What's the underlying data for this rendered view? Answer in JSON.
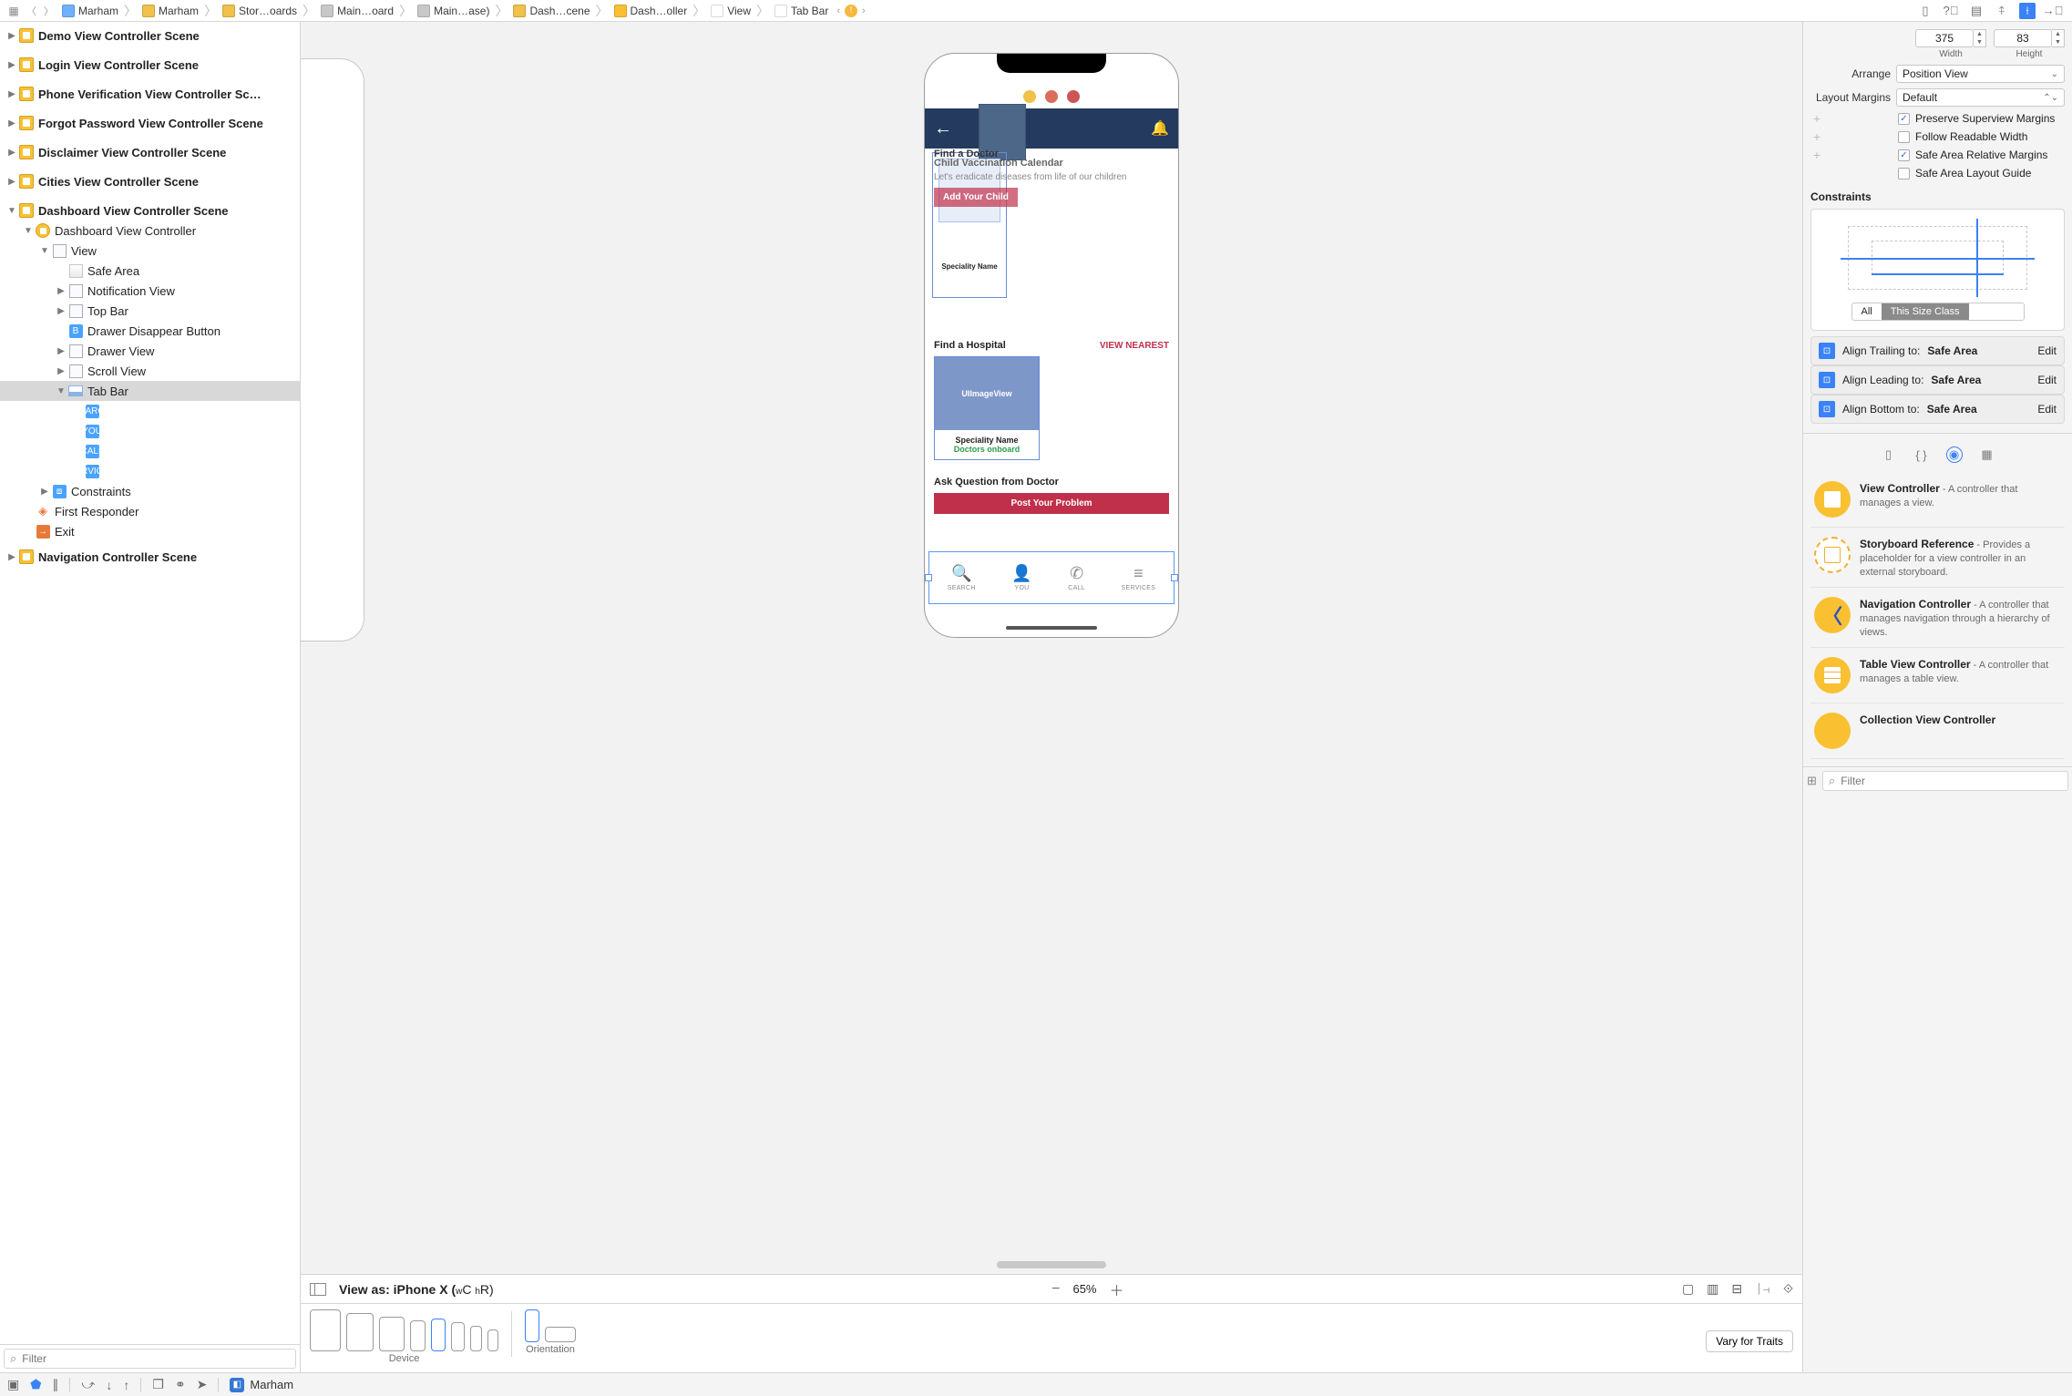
{
  "pathbar": {
    "crumbs": [
      {
        "label": "Marham",
        "iconColor": "#6fb1ff"
      },
      {
        "label": "Marham",
        "iconColor": "#f0c14b"
      },
      {
        "label": "Stor…oards",
        "iconColor": "#f0c14b"
      },
      {
        "label": "Main…oard",
        "iconColor": "#c8c8c8"
      },
      {
        "label": "Main…ase)",
        "iconColor": "#c8c8c8"
      },
      {
        "label": "Dash…cene",
        "iconColor": "#f0c14b"
      },
      {
        "label": "Dash…oller",
        "iconColor": "#f9c132"
      },
      {
        "label": "View",
        "iconColor": "#ffffff"
      },
      {
        "label": "Tab Bar",
        "iconColor": "#ffffff"
      }
    ],
    "tail_nav": {
      "back": "‹",
      "warn": "!",
      "fwd": "›"
    }
  },
  "outline": {
    "scenes": [
      "Demo View Controller Scene",
      "Login View Controller Scene",
      "Phone Verification View Controller Sc…",
      "Forgot Password View Controller Scene",
      "Disclaimer View Controller Scene",
      "Cities View Controller Scene"
    ],
    "dash_scene": "Dashboard View Controller Scene",
    "dash_vc": "Dashboard View Controller",
    "view": "View",
    "safe_area": "Safe Area",
    "notification_view": "Notification View",
    "top_bar": "Top Bar",
    "drawer_btn": "Drawer Disappear Button",
    "drawer_view": "Drawer View",
    "scroll_view": "Scroll View",
    "tab_bar": "Tab Bar",
    "tab_items": [
      "SEARCH",
      "YOU",
      "CALL",
      "SERVICES"
    ],
    "constraints": "Constraints",
    "first_responder": "First Responder",
    "exit": "Exit",
    "nav_scene": "Navigation Controller Scene",
    "filter_placeholder": "Filter"
  },
  "canvas": {
    "ctrl_label": "View as: iPhone X (",
    "ctrl_w": "w",
    "ctrl_c": "C ",
    "ctrl_h": "h",
    "ctrl_r": "R)",
    "zoom": "65%",
    "device_label": "Device",
    "orientation_label": "Orientation",
    "vary": "Vary for Traits"
  },
  "phone": {
    "find_doctor": "Find a Doctor",
    "vacc_calendar": "Child Vaccination Calendar",
    "vacc_sub": "Let's eradicate diseases from life of our children",
    "add_child": "Add Your Child",
    "speciality_name": "Speciality Name",
    "find_hospital": "Find a Hospital",
    "view_nearest": "VIEW NEAREST",
    "uiimageview": "UIImageView",
    "doctors_onboard": "Doctors onboard",
    "ask_question": "Ask Question from Doctor",
    "post_problem": "Post Your Problem",
    "tabs": [
      "SEARCH",
      "YOU",
      "CALL",
      "SERVICES"
    ]
  },
  "inspector": {
    "width_val": "375",
    "height_val": "83",
    "width_label": "Width",
    "height_label": "Height",
    "arrange_label": "Arrange",
    "arrange_val": "Position View",
    "margins_label": "Layout Margins",
    "margins_val": "Default",
    "preserve": "Preserve Superview Margins",
    "follow": "Follow Readable Width",
    "safe_rel": "Safe Area Relative Margins",
    "safe_guide": "Safe Area Layout Guide",
    "constraints_h": "Constraints",
    "seg_all": "All",
    "seg_this": "This Size Class",
    "rows": [
      {
        "label": "Align Trailing to:",
        "val": "Safe Area",
        "edit": "Edit"
      },
      {
        "label": "Align Leading to:",
        "val": "Safe Area",
        "edit": "Edit"
      },
      {
        "label": "Align Bottom to:",
        "val": "Safe Area",
        "edit": "Edit"
      }
    ],
    "library": [
      {
        "title": "View Controller",
        "desc": " - A controller that manages a view.",
        "kind": "vc"
      },
      {
        "title": "Storyboard Reference",
        "desc": " - Provides a placeholder for a view controller in an external storyboard.",
        "kind": "ref"
      },
      {
        "title": "Navigation Controller",
        "desc": " - A controller that manages navigation through a hierarchy of views.",
        "kind": "nav"
      },
      {
        "title": "Table View Controller",
        "desc": " - A controller that manages a table view.",
        "kind": "tbl"
      },
      {
        "title": "Collection View Controller",
        "desc": "",
        "kind": "col"
      }
    ],
    "filter_placeholder": "Filter"
  },
  "statusbar": {
    "project": "Marham"
  }
}
